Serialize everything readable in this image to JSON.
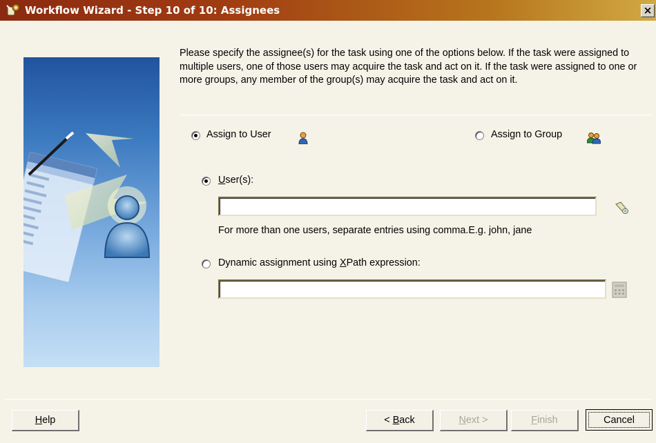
{
  "window": {
    "title": "Workflow Wizard - Step 10 of 10: Assignees",
    "close_glyph": "×"
  },
  "intro_text": "Please specify the assignee(s) for the task using one of the options below. If the task were assigned to multiple users, one of those users may acquire the task and act on it. If the task were assigned to one or more groups, any member of the group(s) may acquire the task and act on it.",
  "assign_options": {
    "user": {
      "label": "Assign to User",
      "checked": true,
      "icon": "user-icon"
    },
    "group": {
      "label": "Assign to Group",
      "checked": false,
      "icon": "group-icon"
    }
  },
  "users_option": {
    "label_pre": "",
    "label_mnemonic": "U",
    "label_post": "ser(s):",
    "checked": true,
    "value": "",
    "lookup_icon": "flashlight-icon",
    "hint": "For more than one users, separate entries using comma.E.g. john, jane"
  },
  "xpath_option": {
    "label_pre": "Dynamic assignment using ",
    "label_mnemonic": "X",
    "label_post": "Path expression:",
    "checked": false,
    "value": "",
    "builder_icon": "calculator-icon"
  },
  "buttons": {
    "help": {
      "pre": "",
      "mn": "H",
      "post": "elp"
    },
    "back": {
      "pre": "< ",
      "mn": "B",
      "post": "ack"
    },
    "next": {
      "pre": "",
      "mn": "N",
      "post": "ext >",
      "disabled": true
    },
    "finish": {
      "pre": "",
      "mn": "F",
      "post": "inish",
      "disabled": true
    },
    "cancel": {
      "label": "Cancel"
    }
  }
}
